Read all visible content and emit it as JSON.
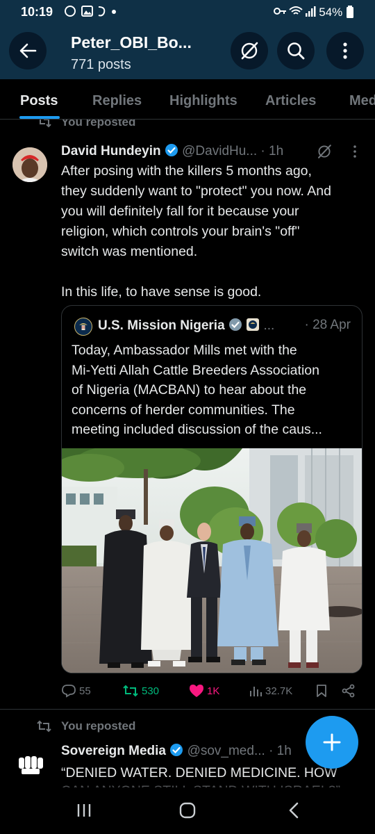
{
  "status_bar": {
    "time": "10:19",
    "battery": "54%"
  },
  "header": {
    "title": "Peter_OBI_Bo...",
    "subtitle": "771 posts"
  },
  "tabs": [
    {
      "label": "Posts",
      "active": true
    },
    {
      "label": "Replies"
    },
    {
      "label": "Highlights"
    },
    {
      "label": "Articles"
    },
    {
      "label": "Med"
    }
  ],
  "post1": {
    "reposted_label": "You reposted",
    "author_name": "David Hundeyin",
    "author_handle": "@DavidHu...",
    "time": "1h",
    "text_lines": [
      "After posing with the killers 5 months ago,",
      "they suddenly want to \"protect\" you now. And",
      "you will definitely fall for it because your",
      "religion, which controls your brain's \"off\"",
      "switch was mentioned.",
      "",
      "In this life, to have sense is good."
    ],
    "quote": {
      "author_name": "U.S. Mission Nigeria",
      "ellipsis": "...",
      "date": "28 Apr",
      "text_lines": [
        "Today, Ambassador Mills met with the",
        "Mi-Yetti Allah Cattle Breeders Association",
        "of Nigeria (MACBAN) to hear about the",
        "concerns of herder communities.  The",
        "meeting included discussion of the caus..."
      ]
    },
    "actions": {
      "replies": "55",
      "reposts": "530",
      "likes": "1K",
      "views": "32.7K"
    }
  },
  "post2": {
    "reposted_label": "You reposted",
    "author_name": "Sovereign Media",
    "author_handle": "@sov_med...",
    "time": "1h",
    "text_line1": "“DENIED WATER. DENIED MEDICINE. HOW",
    "text_line2": "CAN ANYONE STILL STAND WITH ISRAEL?”"
  },
  "colors": {
    "accent": "#1d9bf0",
    "header_bg": "#0f3046",
    "repost_green": "#00ba7c",
    "like_pink": "#f91880",
    "muted": "#71767b"
  }
}
